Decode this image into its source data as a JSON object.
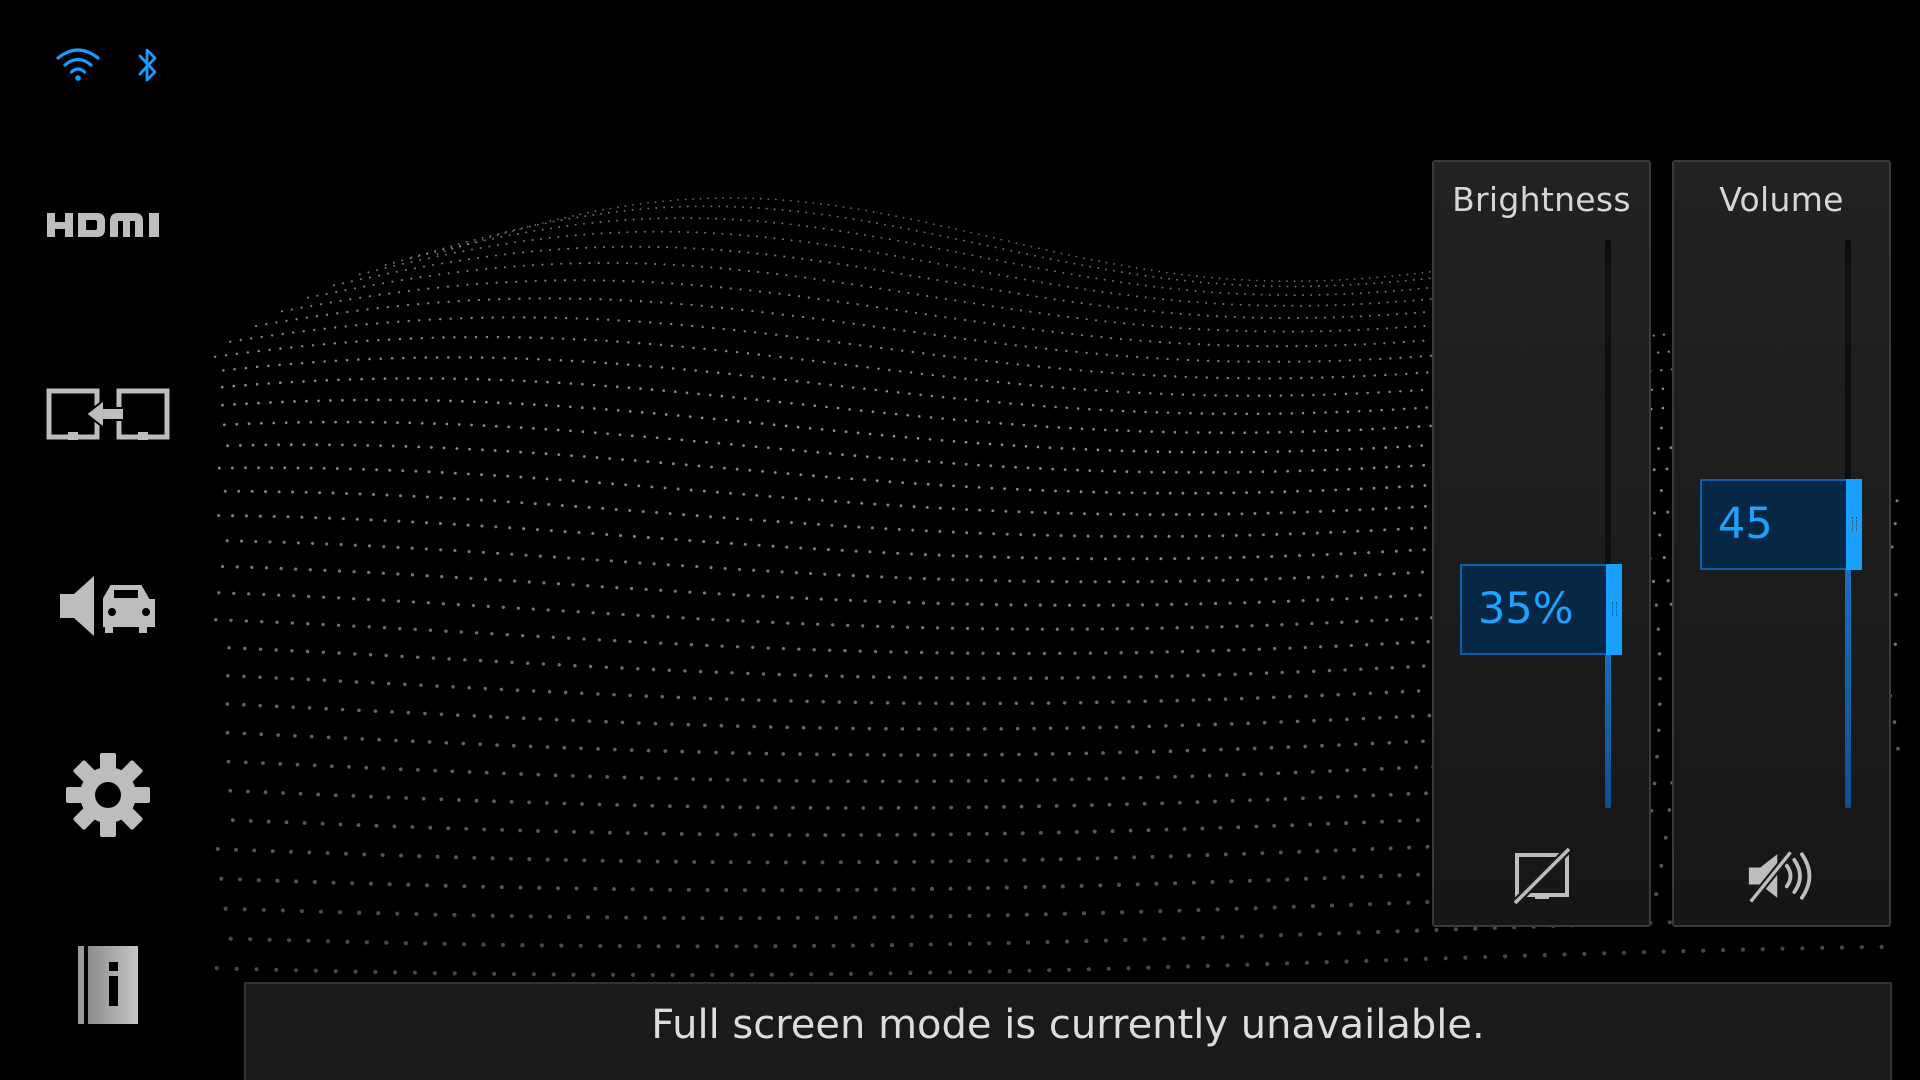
{
  "status": {
    "wifi_icon": "wifi-icon",
    "bluetooth_icon": "bluetooth-icon",
    "accent_color": "#1a9bff"
  },
  "sidebar": {
    "items": [
      {
        "name": "hdmi",
        "icon": "hdmi-icon",
        "label": "HDMI"
      },
      {
        "name": "screen-swap",
        "icon": "screen-swap-icon"
      },
      {
        "name": "car-audio",
        "icon": "car-audio-icon"
      },
      {
        "name": "settings",
        "icon": "gear-icon"
      },
      {
        "name": "info",
        "icon": "info-icon"
      }
    ]
  },
  "panels": {
    "brightness": {
      "title": "Brightness",
      "value_text": "35%",
      "level": 0.35,
      "icon": "display-off-icon"
    },
    "volume": {
      "title": "Volume",
      "value_text": "45",
      "level": 0.5,
      "icon": "mute-icon"
    }
  },
  "notice": {
    "text": "Full screen mode is currently unavailable."
  }
}
